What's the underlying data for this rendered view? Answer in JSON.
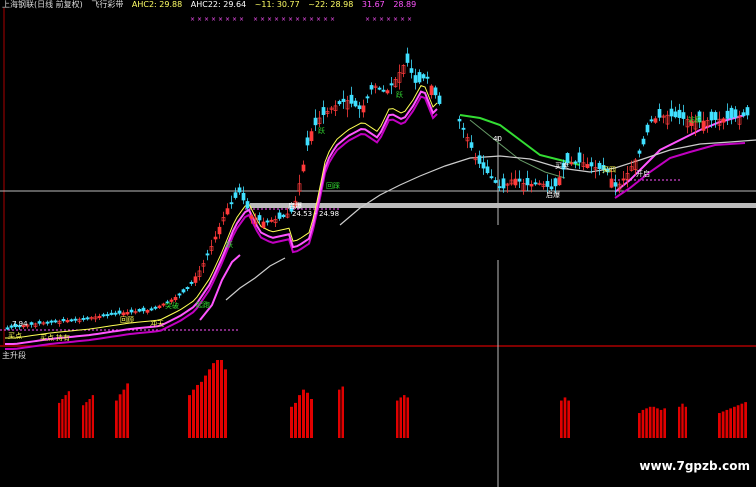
{
  "header": {
    "stock": "上海钢联(日线 前复权)",
    "indicator": "飞行彩带",
    "ahc2": "AHC2: 29.88",
    "ahc22": "AHC22: 29.64",
    "v11": "~11: 30.77",
    "v22": "~22: 28.98",
    "v31": "31.67",
    "v28": "28.89"
  },
  "panel2_title": "主升段",
  "price_labels": {
    "low_price": "7.94",
    "peak_price": "40",
    "range_label": "24.53 - 24.98"
  },
  "annotations": [
    "跃",
    "启爆",
    "持有",
    "突破",
    "买点",
    "冲天",
    "买点",
    "回顾",
    "起跑",
    "跃",
    "跃",
    "买卖",
    "回踩",
    "启爆",
    "开启",
    "站稳",
    "买四"
  ],
  "watermark": "www.7gpzb.com",
  "colors": {
    "up": "#ff3b3b",
    "down": "#40e0ff",
    "band_upper": "#ff55ff",
    "band_lower": "#c000c0",
    "ma_long": "#cccccc",
    "green": "#33dd33",
    "yellow": "#ffff55",
    "bar": "#e00000",
    "divider": "#aa0000"
  },
  "chart_data": {
    "type": "candlestick",
    "bar_panel": {
      "title": "主升段",
      "groups": [
        {
          "from": 58,
          "to": 71,
          "values": [
            0.45,
            0.5,
            0.55,
            0.6
          ]
        },
        {
          "from": 82,
          "to": 95,
          "values": [
            0.42,
            0.46,
            0.5,
            0.55
          ]
        },
        {
          "from": 115,
          "to": 130,
          "values": [
            0.48,
            0.56,
            0.62,
            0.7
          ]
        },
        {
          "from": 188,
          "to": 228,
          "values": [
            0.55,
            0.62,
            0.68,
            0.72,
            0.8,
            0.88,
            0.96,
            1.0,
            1.0,
            0.88
          ]
        },
        {
          "from": 290,
          "to": 314,
          "values": [
            0.4,
            0.45,
            0.55,
            0.62,
            0.58,
            0.5
          ]
        },
        {
          "from": 338,
          "to": 345,
          "values": [
            0.62,
            0.66
          ]
        },
        {
          "from": 396,
          "to": 410,
          "values": [
            0.48,
            0.52,
            0.55,
            0.52
          ]
        },
        {
          "from": 560,
          "to": 571,
          "values": [
            0.48,
            0.52,
            0.48
          ]
        },
        {
          "from": 638,
          "to": 667,
          "values": [
            0.32,
            0.36,
            0.38,
            0.4,
            0.4,
            0.38,
            0.36,
            0.38
          ]
        },
        {
          "from": 678,
          "to": 688,
          "values": [
            0.4,
            0.44,
            0.4
          ]
        },
        {
          "from": 718,
          "to": 748,
          "values": [
            0.32,
            0.34,
            0.36,
            0.38,
            0.4,
            0.42,
            0.44,
            0.46
          ]
        }
      ]
    }
  }
}
